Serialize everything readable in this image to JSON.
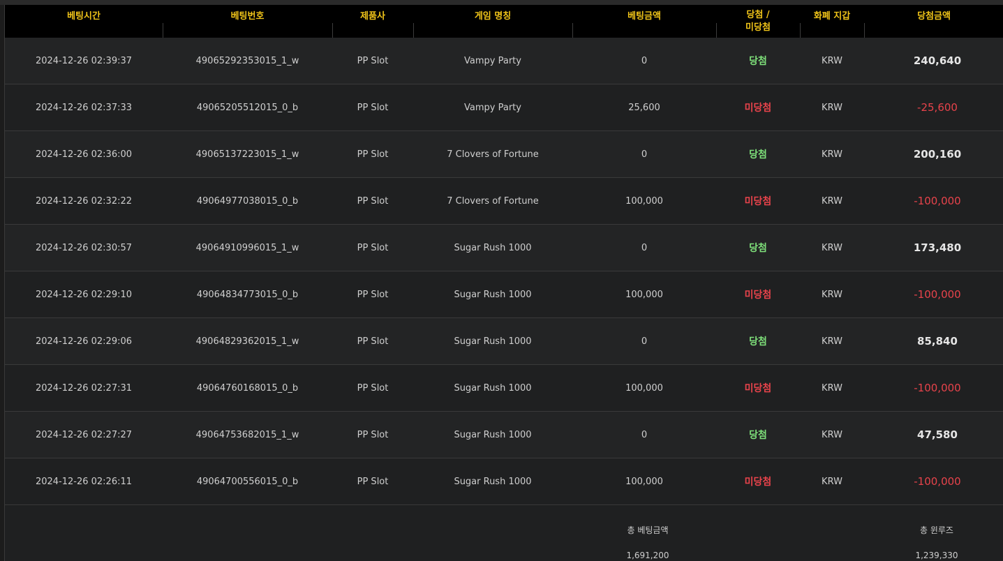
{
  "columns": {
    "time": "베팅시간",
    "bet_no": "베팅번호",
    "provider": "제품사",
    "game": "게임 명칭",
    "bet_amount": "베팅금액",
    "result_line1": "당첨 /",
    "result_line2": "미당첨",
    "currency": "화폐 지갑",
    "win_amount": "당첨금액"
  },
  "rows": [
    {
      "time": "2024-12-26 02:39:37",
      "bet_no": "49065292353015_1_w",
      "provider": "PP Slot",
      "game": "Vampy Party",
      "bet_amount": "0",
      "result": "당첨",
      "result_type": "win",
      "currency": "KRW",
      "win_amount": "240,640"
    },
    {
      "time": "2024-12-26 02:37:33",
      "bet_no": "49065205512015_0_b",
      "provider": "PP Slot",
      "game": "Vampy Party",
      "bet_amount": "25,600",
      "result": "미당첨",
      "result_type": "lose",
      "currency": "KRW",
      "win_amount": "-25,600"
    },
    {
      "time": "2024-12-26 02:36:00",
      "bet_no": "49065137223015_1_w",
      "provider": "PP Slot",
      "game": "7 Clovers of Fortune",
      "bet_amount": "0",
      "result": "당첨",
      "result_type": "win",
      "currency": "KRW",
      "win_amount": "200,160"
    },
    {
      "time": "2024-12-26 02:32:22",
      "bet_no": "49064977038015_0_b",
      "provider": "PP Slot",
      "game": "7 Clovers of Fortune",
      "bet_amount": "100,000",
      "result": "미당첨",
      "result_type": "lose",
      "currency": "KRW",
      "win_amount": "-100,000"
    },
    {
      "time": "2024-12-26 02:30:57",
      "bet_no": "49064910996015_1_w",
      "provider": "PP Slot",
      "game": "Sugar Rush 1000",
      "bet_amount": "0",
      "result": "당첨",
      "result_type": "win",
      "currency": "KRW",
      "win_amount": "173,480"
    },
    {
      "time": "2024-12-26 02:29:10",
      "bet_no": "49064834773015_0_b",
      "provider": "PP Slot",
      "game": "Sugar Rush 1000",
      "bet_amount": "100,000",
      "result": "미당첨",
      "result_type": "lose",
      "currency": "KRW",
      "win_amount": "-100,000"
    },
    {
      "time": "2024-12-26 02:29:06",
      "bet_no": "49064829362015_1_w",
      "provider": "PP Slot",
      "game": "Sugar Rush 1000",
      "bet_amount": "0",
      "result": "당첨",
      "result_type": "win",
      "currency": "KRW",
      "win_amount": "85,840"
    },
    {
      "time": "2024-12-26 02:27:31",
      "bet_no": "49064760168015_0_b",
      "provider": "PP Slot",
      "game": "Sugar Rush 1000",
      "bet_amount": "100,000",
      "result": "미당첨",
      "result_type": "lose",
      "currency": "KRW",
      "win_amount": "-100,000"
    },
    {
      "time": "2024-12-26 02:27:27",
      "bet_no": "49064753682015_1_w",
      "provider": "PP Slot",
      "game": "Sugar Rush 1000",
      "bet_amount": "0",
      "result": "당첨",
      "result_type": "win",
      "currency": "KRW",
      "win_amount": "47,580"
    },
    {
      "time": "2024-12-26 02:26:11",
      "bet_no": "49064700556015_0_b",
      "provider": "PP Slot",
      "game": "Sugar Rush 1000",
      "bet_amount": "100,000",
      "result": "미당첨",
      "result_type": "lose",
      "currency": "KRW",
      "win_amount": "-100,000"
    }
  ],
  "footer": {
    "total_bet_label": "총 베팅금액",
    "total_bet_value": "1,691,200",
    "total_win_label": "총 윈루즈",
    "total_win_value": "1,239,330"
  },
  "colors": {
    "header_text": "#f0c419",
    "win": "#7ee07a",
    "lose": "#e8434b"
  }
}
